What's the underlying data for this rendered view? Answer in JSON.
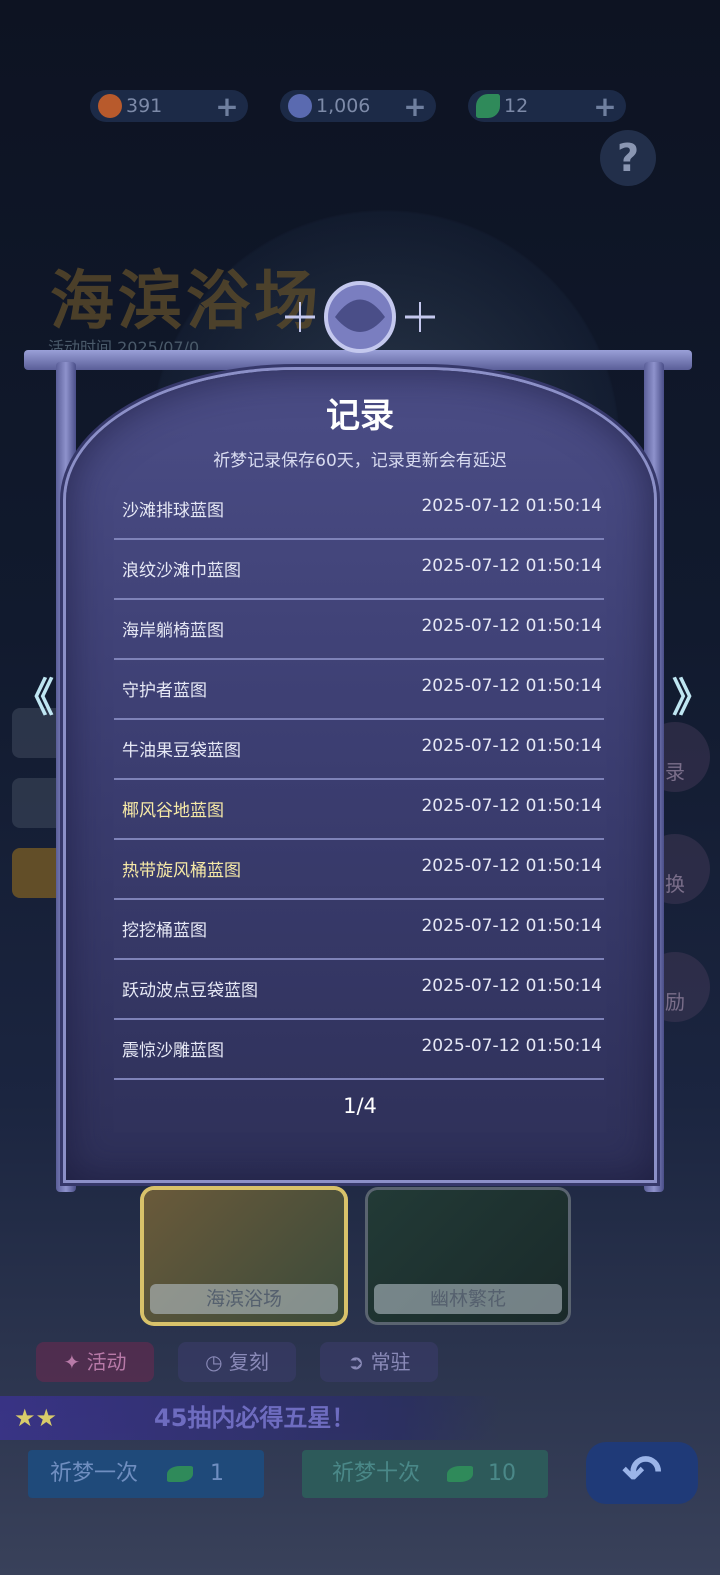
{
  "currencies": [
    {
      "icon": "dream-coin-icon",
      "value": "391",
      "plus": "+",
      "color": "#c0602a"
    },
    {
      "icon": "moon-icon",
      "value": "1,006",
      "plus": "+",
      "color": "#6a7bc0"
    },
    {
      "icon": "leaf-ticket-icon",
      "value": "12",
      "plus": "+",
      "color": "#3aa36a"
    }
  ],
  "help_label": "?",
  "background": {
    "event_title": "海滨浴场",
    "event_date": "活动时间 2025/07/0",
    "side_right": [
      "录",
      "换",
      "励"
    ]
  },
  "modal": {
    "title": "记录",
    "subtitle": "祈梦记录保存60天，记录更新会有延迟",
    "records": [
      {
        "name": "沙滩排球蓝图",
        "time": "2025-07-12 01:50:14"
      },
      {
        "name": "浪纹沙滩巾蓝图",
        "time": "2025-07-12 01:50:14"
      },
      {
        "name": "海岸躺椅蓝图",
        "time": "2025-07-12 01:50:14"
      },
      {
        "name": "守护者蓝图",
        "time": "2025-07-12 01:50:14"
      },
      {
        "name": "牛油果豆袋蓝图",
        "time": "2025-07-12 01:50:14"
      },
      {
        "name": "椰风谷地蓝图",
        "time": "2025-07-12 01:50:14",
        "highlight": true
      },
      {
        "name": "热带旋风桶蓝图",
        "time": "2025-07-12 01:50:14",
        "highlight": true
      },
      {
        "name": "挖挖桶蓝图",
        "time": "2025-07-12 01:50:14"
      },
      {
        "name": "跃动波点豆袋蓝图",
        "time": "2025-07-12 01:50:14"
      },
      {
        "name": "震惊沙雕蓝图",
        "time": "2025-07-12 01:50:14"
      }
    ],
    "pager": "1/4",
    "prev_arrow": "《",
    "next_arrow": "》"
  },
  "banners": [
    {
      "label": "海滨浴场",
      "selected": true
    },
    {
      "label": "幽林繁花",
      "selected": false
    }
  ],
  "tags": [
    {
      "label": "活动",
      "icon": "sparkle-icon"
    },
    {
      "label": "复刻",
      "icon": "clock-icon"
    },
    {
      "label": "常驻",
      "icon": "swirl-icon"
    }
  ],
  "promo": "45抽内必得五星！",
  "pull_once": {
    "label": "祈梦一次",
    "cost": "1"
  },
  "pull_ten": {
    "label": "祈梦十次",
    "cost": "10"
  },
  "back_icon": "return-arrow-icon",
  "colors": {
    "highlight": "#f6e9a6",
    "panel": "#3b3d70"
  }
}
